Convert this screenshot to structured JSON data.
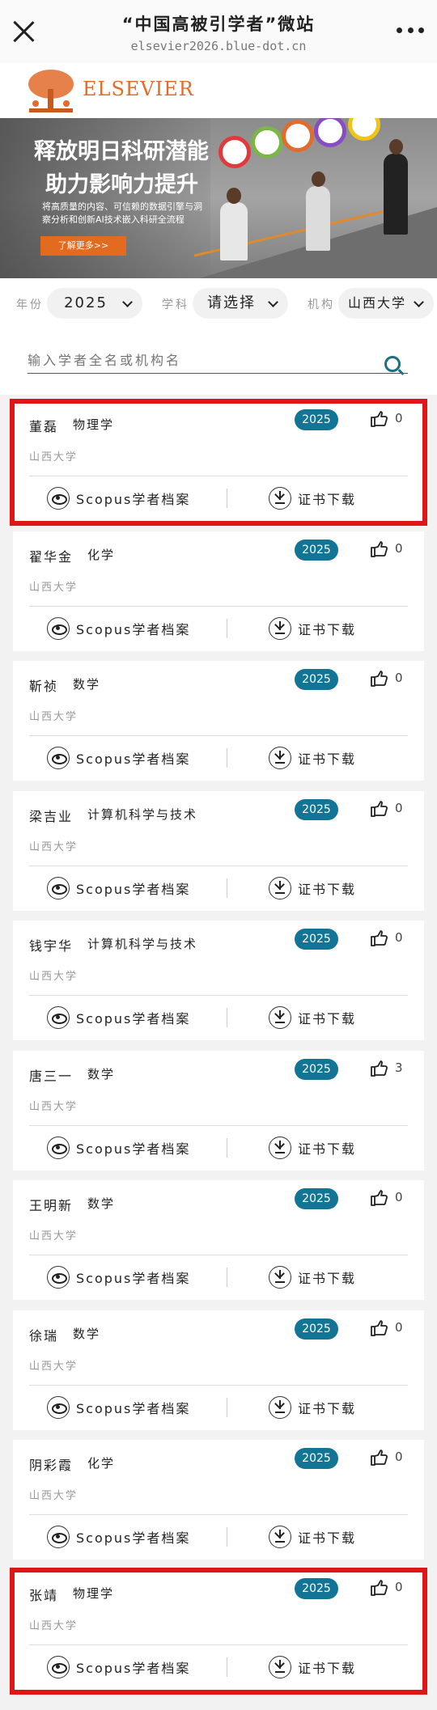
{
  "nav": {
    "title": "“中国高被引学者”微站",
    "url": "elsevier2026.blue-dot.cn"
  },
  "brand": {
    "logo_text": "ELSEVIER",
    "color": "#e36b2c"
  },
  "banner": {
    "headline_1": "释放明日科研潜能",
    "headline_2": "助力影响力提升",
    "subtext": "将高质量的内容、可信赖的数据引擎与洞察分析和创新AI技术嵌入科研全流程",
    "cta": "了解更多>>"
  },
  "filters": {
    "year_label": "年份",
    "year_value": "2025",
    "subject_label": "学科",
    "subject_value": "请选择",
    "org_label": "机构",
    "org_value": "山西大学"
  },
  "search": {
    "placeholder": "输入学者全名或机构名"
  },
  "accent_color": "#137596",
  "highlight_color": "#e01515",
  "card_actions": {
    "scopus_label": "Scopus学者档案",
    "cert_label": "证书下载"
  },
  "scholars": [
    {
      "name": "董磊",
      "subject": "物理学",
      "institution": "山西大学",
      "year": "2025",
      "likes": "0",
      "highlighted": true
    },
    {
      "name": "翟华金",
      "subject": "化学",
      "institution": "山西大学",
      "year": "2025",
      "likes": "0",
      "highlighted": false
    },
    {
      "name": "靳祯",
      "subject": "数学",
      "institution": "山西大学",
      "year": "2025",
      "likes": "0",
      "highlighted": false
    },
    {
      "name": "梁吉业",
      "subject": "计算机科学与技术",
      "institution": "山西大学",
      "year": "2025",
      "likes": "0",
      "highlighted": false
    },
    {
      "name": "钱宇华",
      "subject": "计算机科学与技术",
      "institution": "山西大学",
      "year": "2025",
      "likes": "0",
      "highlighted": false
    },
    {
      "name": "唐三一",
      "subject": "数学",
      "institution": "山西大学",
      "year": "2025",
      "likes": "3",
      "highlighted": false
    },
    {
      "name": "王明新",
      "subject": "数学",
      "institution": "山西大学",
      "year": "2025",
      "likes": "0",
      "highlighted": false
    },
    {
      "name": "徐瑞",
      "subject": "数学",
      "institution": "山西大学",
      "year": "2025",
      "likes": "0",
      "highlighted": false
    },
    {
      "name": "阴彩霞",
      "subject": "化学",
      "institution": "山西大学",
      "year": "2025",
      "likes": "0",
      "highlighted": false
    },
    {
      "name": "张靖",
      "subject": "物理学",
      "institution": "山西大学",
      "year": "2025",
      "likes": "0",
      "highlighted": true
    }
  ]
}
